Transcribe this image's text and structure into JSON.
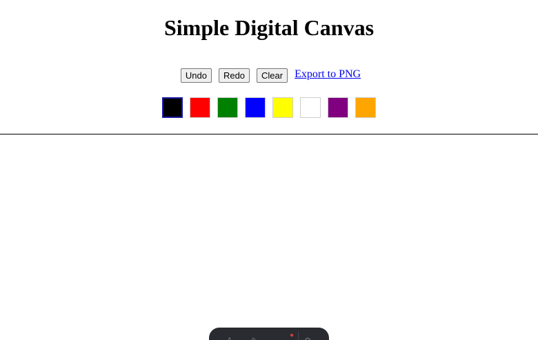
{
  "page": {
    "title": "Simple Digital Canvas"
  },
  "toolbar": {
    "undo_label": "Undo",
    "redo_label": "Redo",
    "clear_label": "Clear",
    "export_label": "Export to PNG"
  },
  "palette": {
    "colors": [
      "#000000",
      "#ff0000",
      "#008000",
      "#0000ff",
      "#ffff00",
      "#ffffff",
      "#800080",
      "#ffa500"
    ],
    "color_names": [
      "black",
      "red",
      "green",
      "blue",
      "yellow",
      "white",
      "purple",
      "orange"
    ],
    "selected": "black"
  },
  "dock": {
    "icons": [
      "text-icon",
      "brush-icon",
      "line-icon",
      "settings-icon"
    ]
  }
}
